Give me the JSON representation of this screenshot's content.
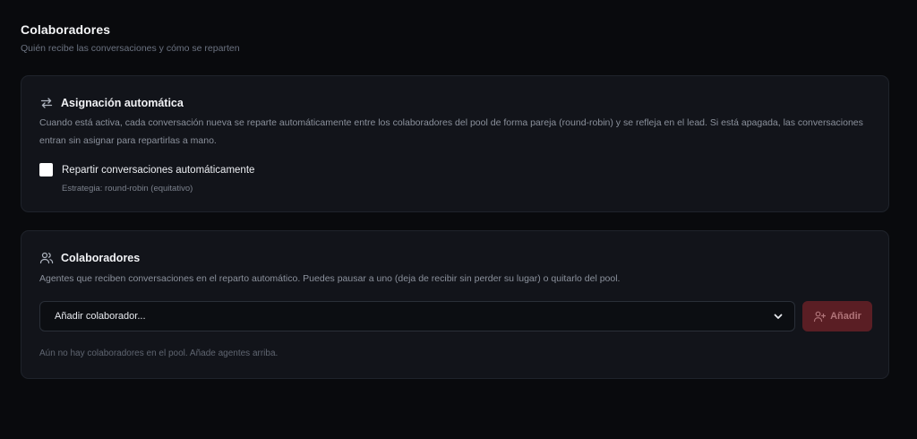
{
  "header": {
    "title": "Colaboradores",
    "subtitle": "Quién recibe las conversaciones y cómo se reparten"
  },
  "auto_assign": {
    "icon": "arrows-swap-icon",
    "title": "Asignación automática",
    "description": "Cuando está activa, cada conversación nueva se reparte automáticamente entre los colaboradores del pool de forma pareja (round-robin) y se refleja en el lead. Si está apagada, las conversaciones entran sin asignar para repartirlas a mano.",
    "checkbox_label": "Repartir conversaciones automáticamente",
    "checked": false,
    "strategy": "Estrategia: round-robin (equitativo)"
  },
  "collaborators": {
    "icon": "users-icon",
    "title": "Colaboradores",
    "description": "Agentes que reciben conversaciones en el reparto automático. Puedes pausar a uno (deja de recibir sin perder su lugar) o quitarlo del pool.",
    "select_placeholder": "Añadir colaborador...",
    "add_label": "Añadir",
    "add_icon": "user-plus-icon",
    "empty_text": "Aún no hay colaboradores en el pool. Añade agentes arriba."
  },
  "colors": {
    "background": "#090a0d",
    "card": "#12141a",
    "accent_disabled": "#5a1e24"
  }
}
